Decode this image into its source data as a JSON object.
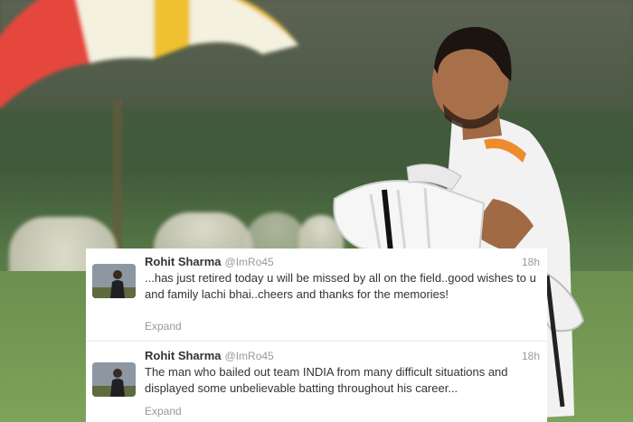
{
  "tweets": [
    {
      "name": "Rohit Sharma",
      "handle": "@ImRo45",
      "time": "18h",
      "text": "...has just retired today u will be missed by all on the field..good wishes to u and family lachi bhai..cheers and thanks for the memories!",
      "expand": "Expand"
    },
    {
      "name": "Rohit Sharma",
      "handle": "@ImRo45",
      "time": "18h",
      "text": "The man who bailed out team INDIA from many difficult situations and displayed some unbelievable batting throughout his career...",
      "expand": "Expand"
    }
  ],
  "colors": {
    "text": "#333333",
    "meta": "#999999",
    "divider": "#e8e8e8",
    "accent_orange": "#f08a2e"
  }
}
